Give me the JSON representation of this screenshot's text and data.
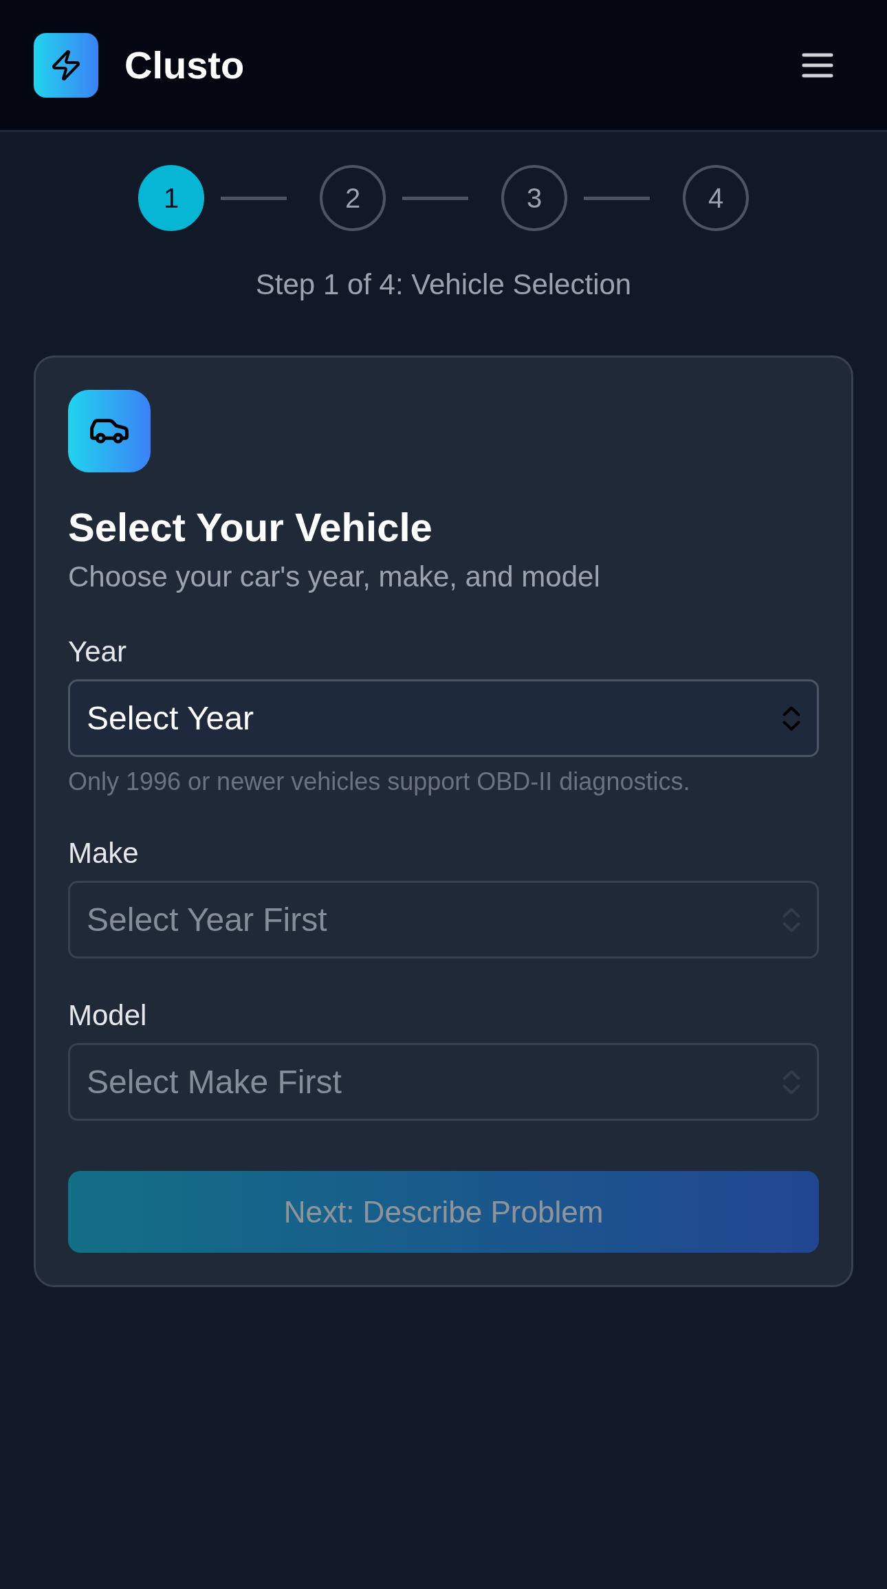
{
  "header": {
    "title": "Clusto"
  },
  "stepper": {
    "steps": [
      {
        "label": "1",
        "selected": true
      },
      {
        "label": "2",
        "selected": false
      },
      {
        "label": "3",
        "selected": false
      },
      {
        "label": "4",
        "selected": false
      }
    ],
    "caption": "Step 1 of 4: Vehicle Selection"
  },
  "card": {
    "title": "Select Your Vehicle",
    "subtitle": "Choose your car's year, make, and model",
    "fields": [
      {
        "label": "Year",
        "value": "Select Year",
        "disabled": false,
        "hint": "Only 1996 or newer vehicles support OBD-II diagnostics."
      },
      {
        "label": "Make",
        "value": "Select Year First",
        "disabled": true
      },
      {
        "label": "Model",
        "value": "Select Make First",
        "disabled": true
      }
    ],
    "button": {
      "label": "Next: Describe Problem",
      "disabled": true
    }
  }
}
